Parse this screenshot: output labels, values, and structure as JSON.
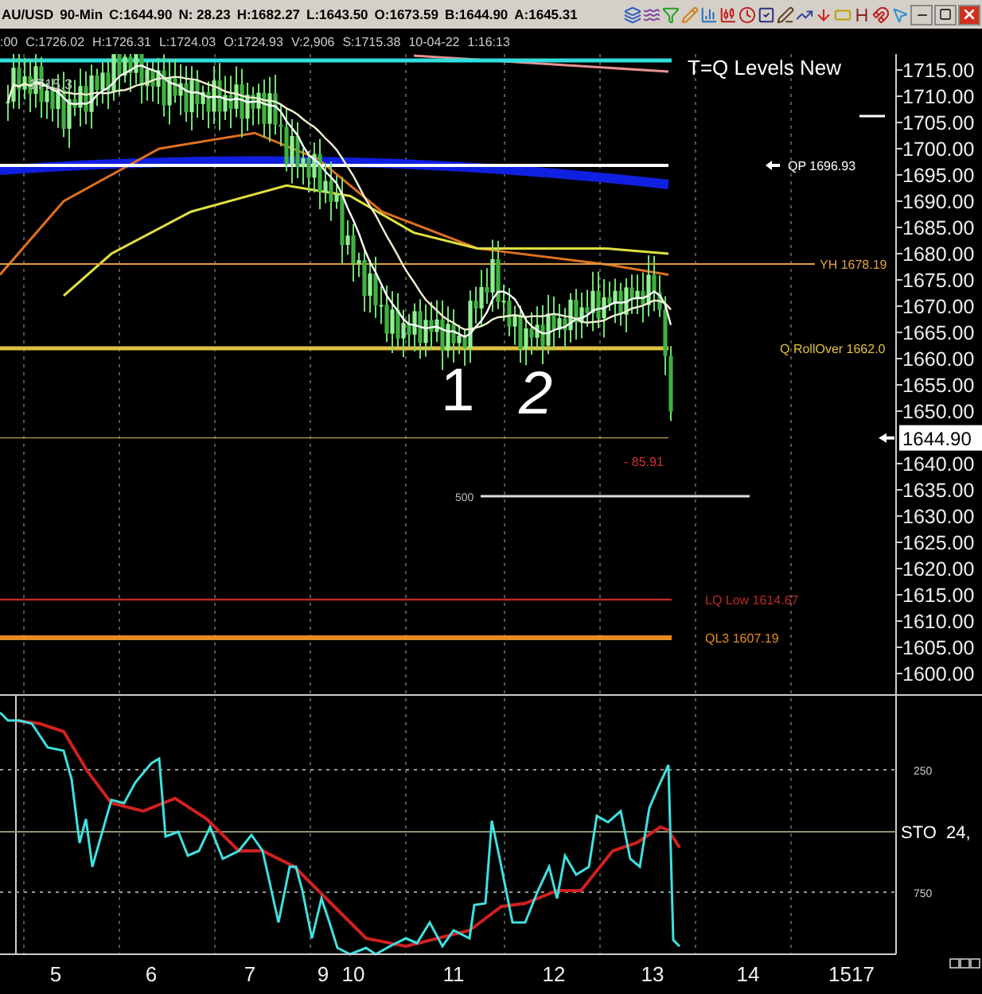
{
  "header": {
    "symbol": "AU/USD",
    "interval": "90-Min",
    "quotes": [
      "C:1644.90",
      "N:  28.23",
      "H:1682.27",
      "L:1643.50",
      "O:1673.59",
      "B:1644.90",
      "A:1645.31"
    ]
  },
  "info_line": [
    ":00",
    "C:1726.02",
    "H:1726.31",
    "L:1724.03",
    "O:1724.93",
    "V:2,906",
    "S:1715.38",
    "10-04-22",
    "1:16:13"
  ],
  "chart_title": "T=Q Levels New",
  "price_marker": "1715.3",
  "levels": [
    {
      "label": "QP 1696.93",
      "color": "#ffffff"
    },
    {
      "label": "YH 1678.19",
      "color": "#e0a040"
    },
    {
      "label": "Q RollOver 1662.0",
      "color": "#e0c040"
    },
    {
      "label": "LQ Low 1614.67",
      "color": "#c02828"
    },
    {
      "label": "QL3 1607.19",
      "color": "#e88a20"
    }
  ],
  "change_label": "- 85.91",
  "fib_label": "500",
  "handwritten_marks": [
    "1",
    "2"
  ],
  "price_axis": {
    "ticks": [
      "1715.00",
      "1710.00",
      "1705.00",
      "1700.00",
      "1695.00",
      "1690.00",
      "1685.00",
      "1680.00",
      "1675.00",
      "1670.00",
      "1665.00",
      "1660.00",
      "1655.00",
      "1650.00",
      "1640.00",
      "1635.00",
      "1630.00",
      "1625.00",
      "1620.00",
      "1615.00",
      "1610.00",
      "1605.00",
      "1600.00"
    ],
    "current_price": "1644.90"
  },
  "indicator": {
    "name": "STO  24,",
    "ticks": [
      "250",
      "750"
    ]
  },
  "time_axis": [
    "5",
    "6",
    "7",
    "9",
    "10",
    "11",
    "12",
    "13",
    "14",
    "1517"
  ]
}
